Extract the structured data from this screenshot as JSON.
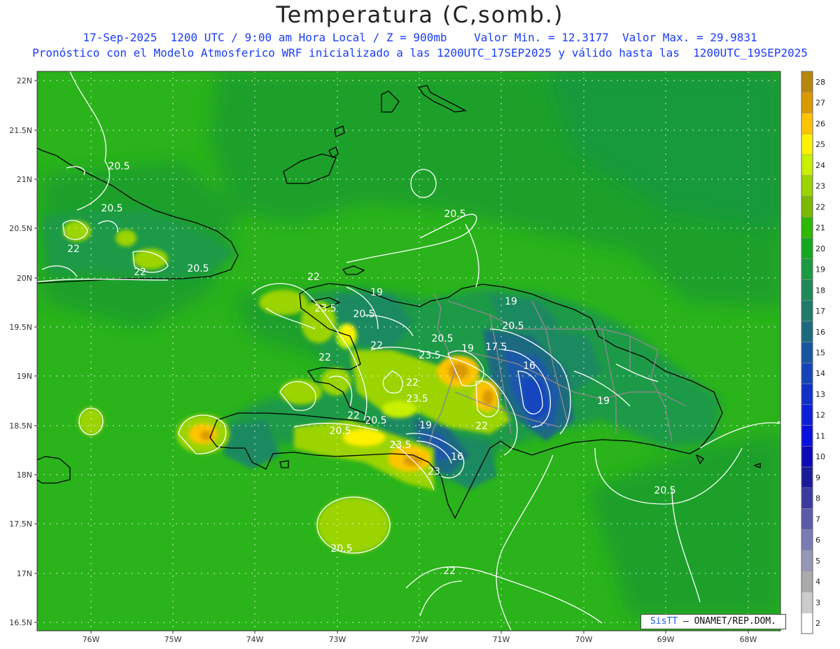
{
  "header": {
    "title": "Temperatura (C,somb.)",
    "line1": "17-Sep-2025  1200 UTC / 9:00 am Hora Local / Z = 900mb    Valor Min. = 12.3177  Valor Max. = 29.9831",
    "line2": "Pronóstico con el Modelo Atmosferico WRF inicializado a las 1200UTC_17SEP2025 y válido hasta las  1200UTC_19SEP2025"
  },
  "axes": {
    "lat_labels": [
      "22N",
      "21.5N",
      "21N",
      "20.5N",
      "20N",
      "19.5N",
      "19N",
      "18.5N",
      "18N",
      "17.5N",
      "17N",
      "16.5N"
    ],
    "lon_labels": [
      "76W",
      "75W",
      "74W",
      "73W",
      "72W",
      "71W",
      "70W",
      "69W",
      "68W"
    ]
  },
  "colorbar": {
    "labels": [
      "28",
      "27",
      "26",
      "25",
      "24",
      "23",
      "22",
      "21",
      "20",
      "19",
      "18",
      "17",
      "16",
      "15",
      "14",
      "13",
      "12",
      "11",
      "10",
      "9",
      "8",
      "7",
      "6",
      "5",
      "4",
      "3",
      "2"
    ],
    "colors": [
      "#b8860b",
      "#d99a00",
      "#ffc400",
      "#fff200",
      "#c8f000",
      "#9bd400",
      "#7bb800",
      "#2fb800",
      "#12a81f",
      "#1c9a42",
      "#1f8a58",
      "#1f7a6a",
      "#1c6a7f",
      "#1856a0",
      "#1444b8",
      "#1030c8",
      "#0c20d8",
      "#0810e0",
      "#0a0ab8",
      "#1a1a9a",
      "#3a3a9e",
      "#5a5aa8",
      "#7a7ab4",
      "#9696b8",
      "#aaaaaa",
      "#cccccc",
      "#ffffff"
    ]
  },
  "contour_labels": [
    {
      "text": "20.5"
    },
    {
      "text": "20.5"
    },
    {
      "text": "22"
    },
    {
      "text": "22"
    },
    {
      "text": "20.5"
    },
    {
      "text": "22"
    },
    {
      "text": "19"
    },
    {
      "text": "23.5"
    },
    {
      "text": "20.5"
    },
    {
      "text": "22"
    },
    {
      "text": "22"
    },
    {
      "text": "20.5"
    },
    {
      "text": "23.5"
    },
    {
      "text": "19"
    },
    {
      "text": "17.5"
    },
    {
      "text": "16"
    },
    {
      "text": "22"
    },
    {
      "text": "23.5"
    },
    {
      "text": "20.5"
    },
    {
      "text": "22"
    },
    {
      "text": "19"
    },
    {
      "text": "22"
    },
    {
      "text": "23.5"
    },
    {
      "text": "16"
    },
    {
      "text": "23"
    },
    {
      "text": "19"
    },
    {
      "text": "20.5"
    },
    {
      "text": "19"
    },
    {
      "text": "20.5"
    },
    {
      "text": "20.5"
    },
    {
      "text": "22"
    },
    {
      "text": "20.5"
    },
    {
      "text": "20.5"
    }
  ],
  "credit": {
    "brand": "SisTT",
    "text": "– ONAMET/REP.DOM."
  }
}
